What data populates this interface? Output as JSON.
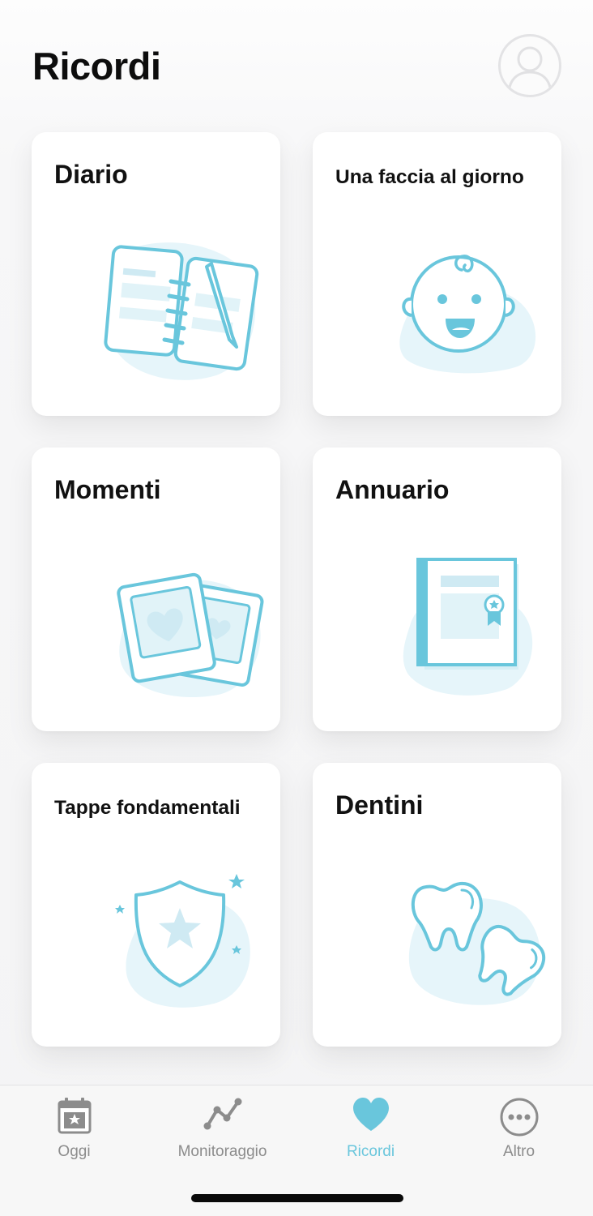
{
  "header": {
    "title": "Ricordi"
  },
  "cards": [
    {
      "id": "diario",
      "title": "Diario",
      "icon": "diary-notebook-icon"
    },
    {
      "id": "una-faccia",
      "title": "Una faccia al giorno",
      "icon": "baby-face-icon"
    },
    {
      "id": "momenti",
      "title": "Momenti",
      "icon": "photo-heart-icon"
    },
    {
      "id": "annuario",
      "title": "Annuario",
      "icon": "yearbook-icon"
    },
    {
      "id": "tappe",
      "title": "Tappe fondamentali",
      "icon": "shield-star-icon"
    },
    {
      "id": "dentini",
      "title": "Dentini",
      "icon": "tooth-icon"
    }
  ],
  "tabbar": {
    "items": [
      {
        "label": "Oggi",
        "icon": "calendar-star-icon",
        "active": false
      },
      {
        "label": "Monitoraggio",
        "icon": "line-chart-icon",
        "active": false
      },
      {
        "label": "Ricordi",
        "icon": "heart-icon",
        "active": true
      },
      {
        "label": "Altro",
        "icon": "more-dots-icon",
        "active": false
      }
    ]
  },
  "colors": {
    "accent": "#69c6dc",
    "accent_light": "#e6f5fa",
    "inactive": "#8c8c8c",
    "card_bg": "#ffffff"
  }
}
